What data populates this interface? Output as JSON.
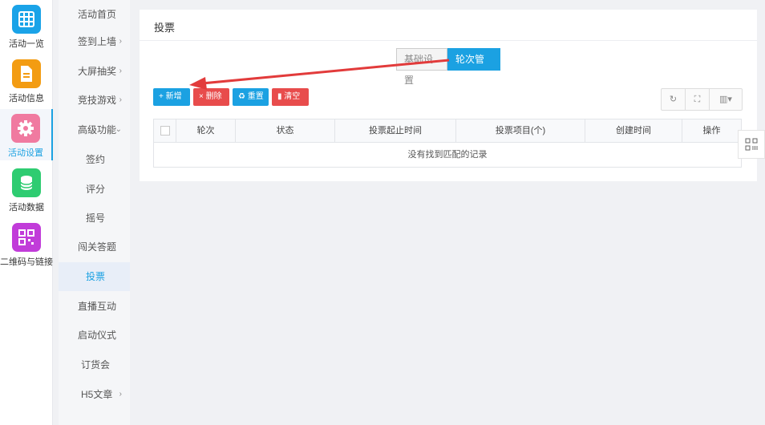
{
  "rail": {
    "items": [
      {
        "label": "活动一览",
        "icon": "grid-icon",
        "color": "#1aa3e8"
      },
      {
        "label": "活动信息",
        "icon": "document-icon",
        "color": "#f39c12"
      },
      {
        "label": "活动设置",
        "icon": "gear-icon",
        "color": "#f07aa0"
      },
      {
        "label": "活动数据",
        "icon": "database-icon",
        "color": "#2ecc71"
      },
      {
        "label": "二维码与链接",
        "icon": "qrcode-icon",
        "color": "#c13cd9"
      }
    ]
  },
  "menu": {
    "items": [
      {
        "label": "活动首页",
        "caret": ""
      },
      {
        "label": "签到上墙",
        "caret": "›"
      },
      {
        "label": "大屏抽奖",
        "caret": "›"
      },
      {
        "label": "竞技游戏",
        "caret": "›"
      },
      {
        "label": "高级功能",
        "caret": "⌄"
      },
      {
        "label": "签约",
        "caret": ""
      },
      {
        "label": "评分",
        "caret": ""
      },
      {
        "label": "摇号",
        "caret": ""
      },
      {
        "label": "闯关答题",
        "caret": ""
      },
      {
        "label": "投票",
        "caret": ""
      },
      {
        "label": "直播互动",
        "caret": ""
      },
      {
        "label": "启动仪式",
        "caret": ""
      },
      {
        "label": "订货会",
        "caret": ""
      },
      {
        "label": "H5文章",
        "caret": "›"
      }
    ]
  },
  "panel": {
    "title": "投票",
    "tabs": [
      "基础设置",
      "轮次管理"
    ]
  },
  "toolbar": {
    "add": "+ 新增",
    "delete": "× 删除",
    "reset": "♻ 重置",
    "clear": "▮ 清空",
    "refresh": "↻",
    "fullscreen": "⛶",
    "columns": "▥▾"
  },
  "table": {
    "headers": [
      "轮次",
      "状态",
      "投票起止时间",
      "投票项目(个)",
      "创建时间",
      "操作"
    ],
    "empty_text": "没有找到匹配的记录"
  },
  "colors": {
    "accent": "#1ba1e2",
    "danger": "#e84c4c",
    "arrow": "#e23b3b"
  }
}
